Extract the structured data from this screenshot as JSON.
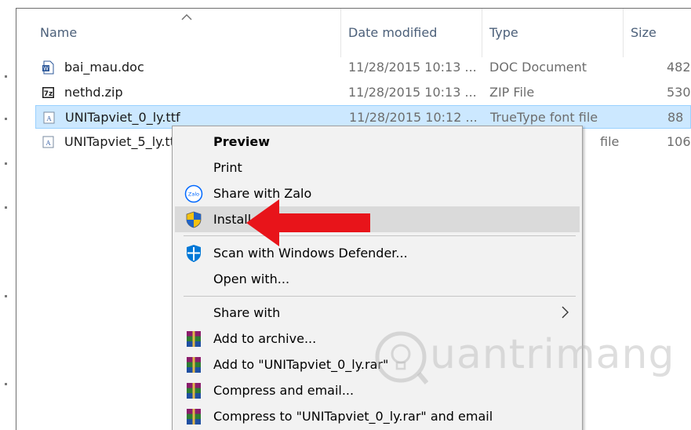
{
  "columns": {
    "name": "Name",
    "date_modified": "Date modified",
    "type": "Type",
    "size": "Size"
  },
  "files": [
    {
      "name": "bai_mau.doc",
      "date": "11/28/2015 10:13 ...",
      "type": "DOC Document",
      "size": "482",
      "icon": "word-doc-icon"
    },
    {
      "name": "nethd.zip",
      "date": "11/28/2015 10:13 ...",
      "type": "ZIP File",
      "size": "530",
      "icon": "7zip-icon"
    },
    {
      "name": "UNITapviet_0_ly.ttf",
      "date": "11/28/2015 10:12 ...",
      "type": "TrueType font file",
      "size": "88",
      "icon": "truetype-font-icon",
      "selected": true
    },
    {
      "name": "UNITapviet_5_ly.ttf",
      "date": "",
      "type": "file",
      "size": "106",
      "icon": "truetype-font-icon"
    }
  ],
  "context_menu": {
    "items": [
      {
        "label": "Preview",
        "bold": true
      },
      {
        "label": "Print"
      },
      {
        "label": "Share with Zalo",
        "icon": "zalo-icon"
      },
      {
        "label": "Install",
        "icon": "uac-shield-icon",
        "hover": true
      },
      {
        "label": "Scan with Windows Defender...",
        "icon": "windows-defender-icon"
      },
      {
        "label": "Open with..."
      },
      {
        "label": "Share with",
        "submenu": true
      },
      {
        "label": "Add to archive...",
        "icon": "winrar-icon"
      },
      {
        "label": "Add to \"UNITapviet_0_ly.rar\"",
        "icon": "winrar-icon"
      },
      {
        "label": "Compress and email...",
        "icon": "winrar-icon"
      },
      {
        "label": "Compress to \"UNITapviet_0_ly.rar\" and email",
        "icon": "winrar-icon"
      }
    ]
  },
  "watermark": {
    "text": "uantrimang"
  },
  "colors": {
    "selection_bg": "#cce8ff",
    "selection_border": "#99d1ff",
    "header_text": "#4c607a",
    "menu_bg": "#f2f2f2",
    "menu_hover": "#dadada",
    "arrow_red": "#e8141a"
  }
}
